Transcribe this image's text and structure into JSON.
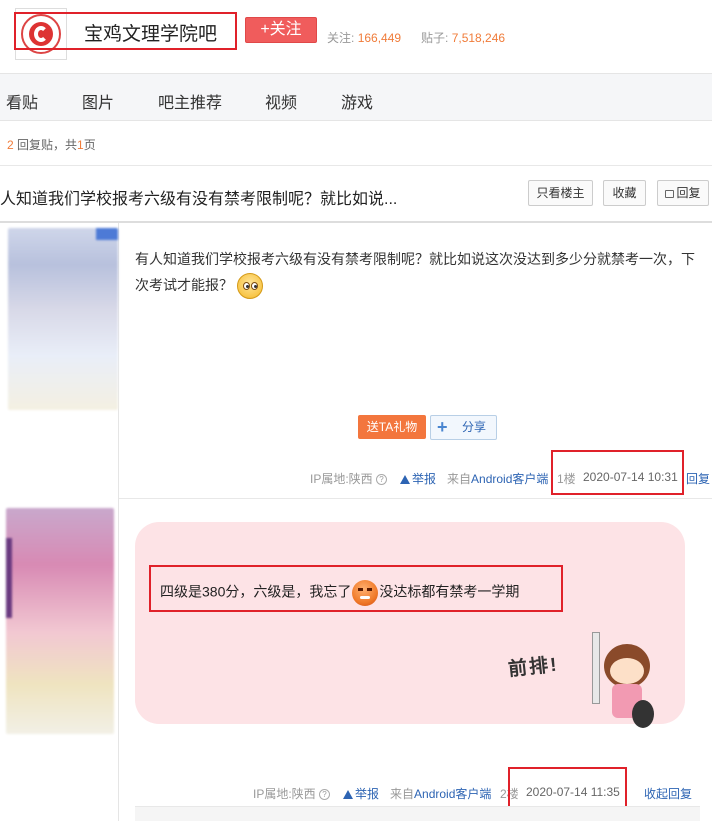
{
  "header": {
    "bar_title": "宝鸡文理学院吧",
    "follow_label": "+关注",
    "followers_label": "关注:",
    "followers_value": "166,449",
    "posts_label": "贴子:",
    "posts_value": "7,518,246"
  },
  "nav": {
    "items": [
      {
        "label": "看贴"
      },
      {
        "label": "图片"
      },
      {
        "label": "吧主推荐"
      },
      {
        "label": "视频"
      },
      {
        "label": "游戏"
      }
    ]
  },
  "reply_summary": {
    "count": "2",
    "text_mid": "回复贴，共",
    "pages": "1",
    "text_end": "页"
  },
  "thread": {
    "title": "人知道我们学校报考六级有没有禁考限制呢？就比如说...",
    "only_op_label": "只看楼主",
    "collect_label": "收藏",
    "reply_label": "回复"
  },
  "posts": [
    {
      "content": "有人知道我们学校报考六级有没有禁考限制呢？就比如说这次没达到多少分就禁考一次，下次考试才能报？",
      "gift_label": "送TA礼物",
      "share_label": "分享",
      "ip_label": "IP属地:陕西",
      "report_label": "举报",
      "source_prefix": "来自",
      "source_app": "Android客户端",
      "floor": "1楼",
      "time": "2020-07-14 10:31",
      "reply_label": "回复"
    },
    {
      "content_before": "四级是380分，六级是，我忘了",
      "content_after": "没达标都有禁考一学期",
      "sticker_text": "前排!",
      "ip_label": "IP属地:陕西",
      "report_label": "举报",
      "source_prefix": "来自",
      "source_app": "Android客户端",
      "floor": "2楼",
      "time": "2020-07-14 11:35",
      "reply_label": "收起回复"
    }
  ],
  "colors": {
    "accent_red": "#e0212a",
    "follow_button": "#f05c5c",
    "link_blue": "#2d64b3",
    "count_orange": "#f07c3a",
    "bubble_pink": "#fde3e6"
  }
}
